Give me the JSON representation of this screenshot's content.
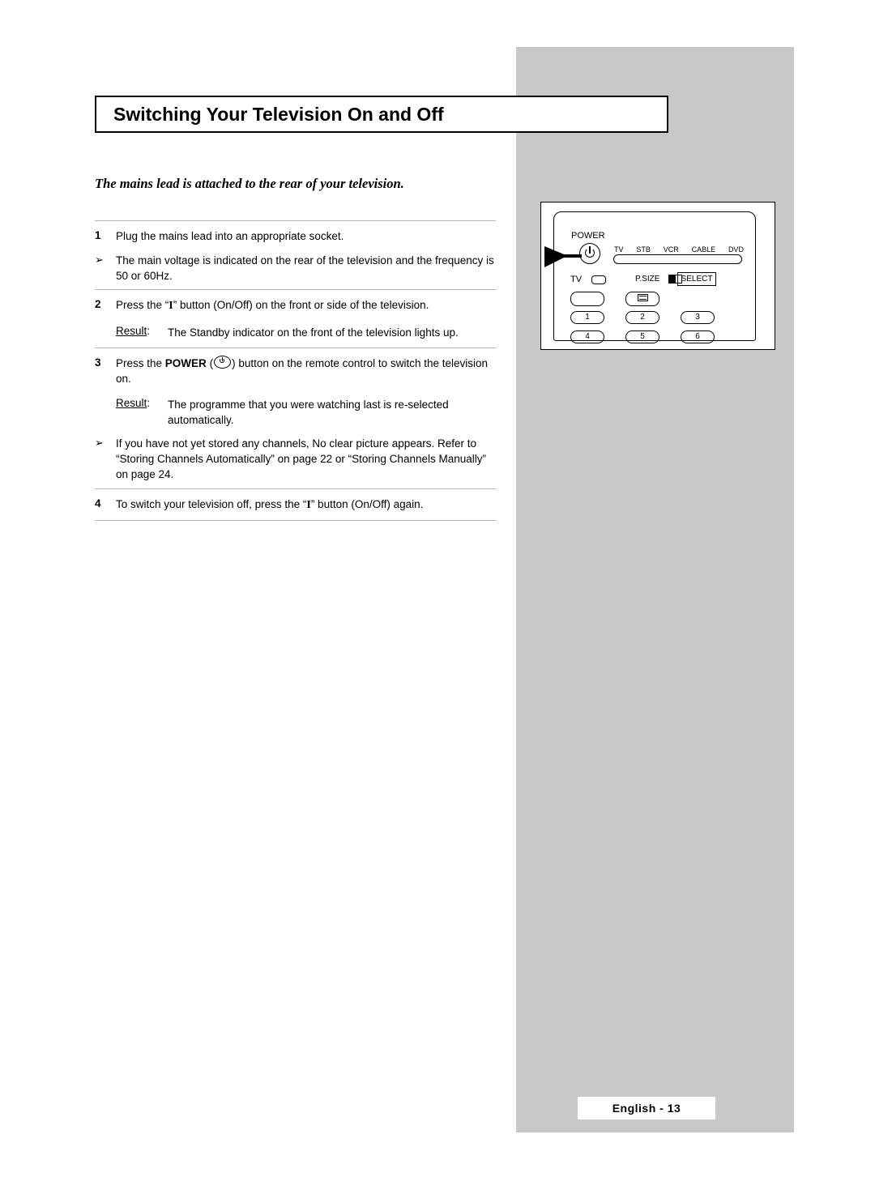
{
  "page": {
    "title": "Switching Your Television On and Off",
    "intro": "The mains lead is attached to the rear of your television.",
    "footer": "English - 13"
  },
  "steps": [
    {
      "number": "1",
      "text": "Plug the mains lead into an appropriate socket.",
      "bullet": "The main voltage is indicated on the rear of the television and the frequency is 50 or 60Hz."
    },
    {
      "number": "2",
      "text_before": "Press the “",
      "symbol": "I",
      "text_after": "” button (On/Off) on the front or side of the television.",
      "result_label": "Result",
      "result_colon": ":",
      "result_text": "The Standby indicator on the front of the television lights up."
    },
    {
      "number": "3",
      "text_before": "Press the ",
      "bold_word": "POWER",
      "text_paren_open": "(",
      "text_paren_close": ")",
      "text_after": "button on the remote control to switch the television on.",
      "result_label": "Result",
      "result_colon": ":",
      "result_text": "The programme that you were watching last is re-selected automatically.",
      "bullet": "If you have not yet stored any channels, No clear picture appears. Refer to “Storing Channels Automatically” on page 22 or “Storing Channels Manually” on page 24."
    },
    {
      "number": "4",
      "text_before": "To switch your television off, press the “",
      "symbol": "I",
      "text_after": "” button (On/Off) again."
    }
  ],
  "remote": {
    "power_label": "POWER",
    "devices": [
      "TV",
      "STB",
      "VCR",
      "CABLE",
      "DVD"
    ],
    "tv_label": "TV",
    "psize_label": "P.SIZE",
    "select_label": "SELECT",
    "buttons": [
      "1",
      "2",
      "3",
      "4",
      "5",
      "6"
    ]
  },
  "bullet_mark": "➢"
}
